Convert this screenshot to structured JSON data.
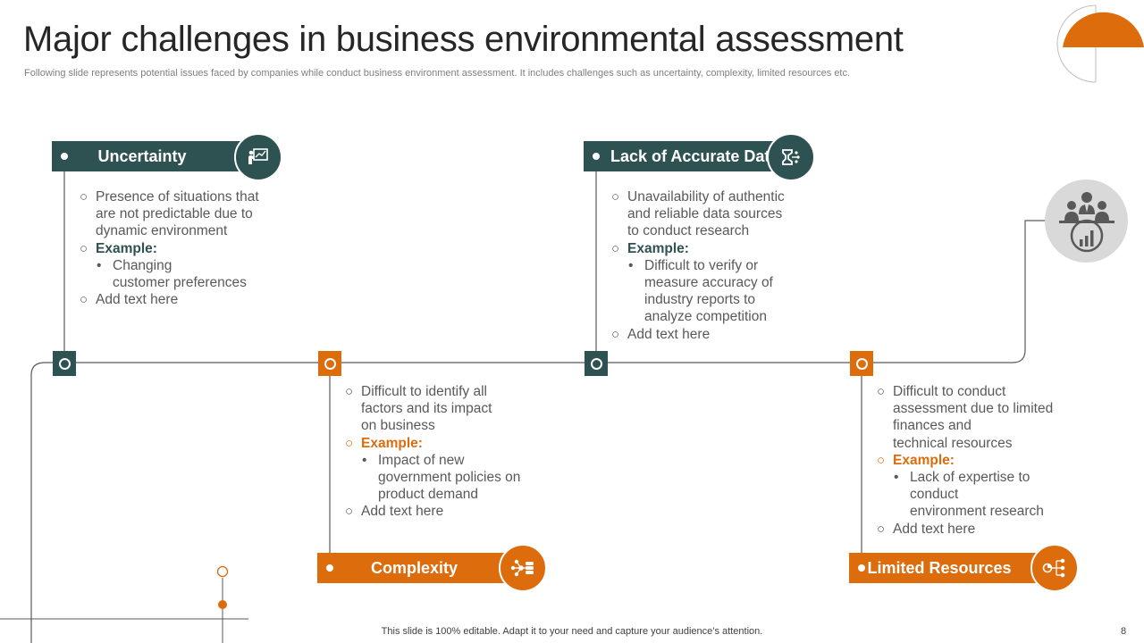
{
  "title": "Major challenges in business environmental assessment",
  "subtitle": "Following slide represents potential issues faced by companies while conduct business environment assessment. It includes challenges such as uncertainty, complexity, limited resources etc.",
  "footer": "This slide is 100% editable. Adapt it to your need and capture your audience’s attention.",
  "page_number": "8",
  "colors": {
    "teal": "#2e5251",
    "orange": "#dd6c0d",
    "gray": "#d9d9d9"
  },
  "challenges": [
    {
      "heading": "Uncertainty",
      "icon": "presentation-chart-icon",
      "point1": [
        "Presence of situations that",
        "are not predictable due to",
        "dynamic environment"
      ],
      "example_label": "Example:",
      "example": [
        "Changing",
        "customer preferences"
      ],
      "point3": "Add text here"
    },
    {
      "heading": "Complexity",
      "icon": "network-database-icon",
      "point1": [
        "Difficult to identify all",
        "factors and its impact",
        "on business"
      ],
      "example_label": "Example:",
      "example": [
        "Impact of new",
        "government  policies on",
        "product demand"
      ],
      "point3": "Add text here"
    },
    {
      "heading": "Lack of Accurate Data",
      "icon": "data-funnel-icon",
      "point1": [
        "Unavailability  of authentic",
        "and reliable data sources",
        "to conduct research"
      ],
      "example_label": "Example:",
      "example": [
        "Difficult to verify  or",
        "measure accuracy of",
        "industry reports to",
        "analyze competition"
      ],
      "point3": "Add text here"
    },
    {
      "heading": "Limited Resources",
      "icon": "resource-network-icon",
      "point1": [
        "Difficult to conduct",
        "assessment due to limited",
        "finances and",
        "technical resources"
      ],
      "example_label": "Example:",
      "example": [
        "Lack of expertise to",
        "conduct",
        "environment  research"
      ],
      "point3": "Add text here"
    }
  ],
  "goal_icon": "team-growth-icon"
}
